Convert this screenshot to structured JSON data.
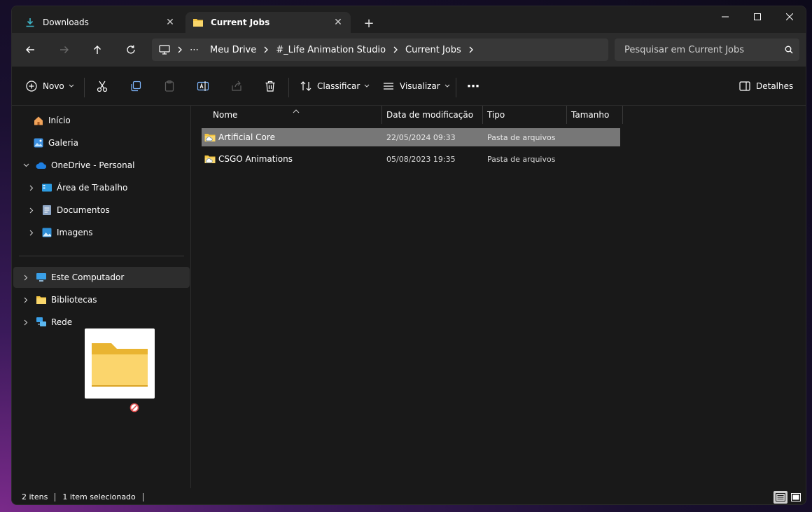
{
  "tabs": [
    {
      "label": "Downloads",
      "icon": "download-icon",
      "active": false
    },
    {
      "label": "Current Jobs",
      "icon": "folder-icon",
      "active": true
    }
  ],
  "breadcrumb": [
    "Meu Drive",
    "#_Life Animation Studio",
    "Current Jobs"
  ],
  "breadcrumb_more": "⋯",
  "search": {
    "placeholder": "Pesquisar em Current Jobs"
  },
  "toolbar": {
    "new_label": "Novo",
    "sort_label": "Classificar",
    "view_label": "Visualizar",
    "more": "⋯",
    "details_label": "Detalhes"
  },
  "sidebar": {
    "items": [
      {
        "label": "Início",
        "icon": "home-icon"
      },
      {
        "label": "Galeria",
        "icon": "gallery-icon"
      },
      {
        "label": "OneDrive - Personal",
        "icon": "onedrive-icon"
      },
      {
        "label": "Área de Trabalho",
        "icon": "desktop-icon"
      },
      {
        "label": "Documentos",
        "icon": "documents-icon"
      },
      {
        "label": "Imagens",
        "icon": "pictures-icon"
      },
      {
        "label": "Este Computador",
        "icon": "computer-icon"
      },
      {
        "label": "Bibliotecas",
        "icon": "libraries-icon"
      },
      {
        "label": "Rede",
        "icon": "network-icon"
      }
    ]
  },
  "columns": [
    "Nome",
    "Data de modificação",
    "Tipo",
    "Tamanho"
  ],
  "files": [
    {
      "name": "Artificial Core",
      "date": "22/05/2024 09:33",
      "type": "Pasta de arquivos",
      "selected": true
    },
    {
      "name": "CSGO Animations",
      "date": "05/08/2023 19:35",
      "type": "Pasta de arquivos",
      "selected": false
    }
  ],
  "status": {
    "count": "2 itens",
    "selection": "1 item selecionado"
  },
  "colors": {
    "accent": "#0078d4",
    "folder": "#f4c542",
    "selected_row": "#777777"
  }
}
